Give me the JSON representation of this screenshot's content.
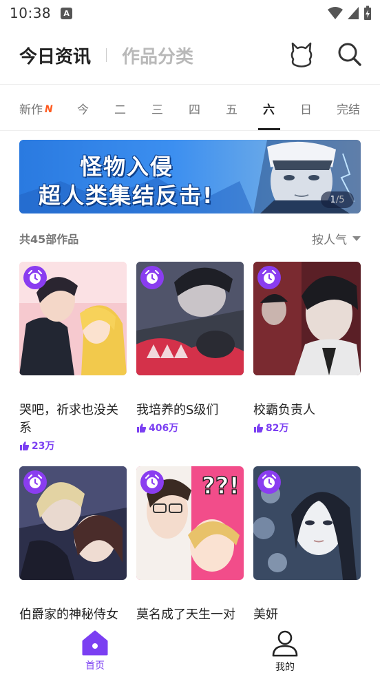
{
  "status_bar": {
    "time": "10:38",
    "notification_icon": "a-box-icon"
  },
  "header": {
    "active_tab": "今日资讯",
    "tab2": "作品分类",
    "icons": [
      "bear-icon",
      "search-icon"
    ]
  },
  "day_tabs": {
    "items": [
      {
        "label": "新作",
        "badge": "N"
      },
      {
        "label": "今"
      },
      {
        "label": "二"
      },
      {
        "label": "三"
      },
      {
        "label": "四"
      },
      {
        "label": "五"
      },
      {
        "label": "六"
      },
      {
        "label": "日"
      },
      {
        "label": "完结"
      }
    ],
    "selected": "六"
  },
  "banner": {
    "line1": "怪物入侵",
    "line2": "超人类集结反击!",
    "current": "1",
    "total": "/5"
  },
  "list": {
    "count_text": "共45部作品",
    "sort_label": "按人气"
  },
  "cards": [
    {
      "title": "哭吧，祈求也没关系",
      "likes": "23万"
    },
    {
      "title": "我培养的S级们",
      "likes": "406万"
    },
    {
      "title": "校霸负责人",
      "likes": "82万"
    },
    {
      "title": "伯爵家的神秘侍女",
      "likes": ""
    },
    {
      "title": "莫名成了天生一对",
      "likes": ""
    },
    {
      "title": "美妍",
      "likes": ""
    }
  ],
  "bottom_nav": {
    "home": "首页",
    "me": "我的",
    "active_color": "#7b3ff2"
  },
  "colors": {
    "accent": "#7b3ff2",
    "new_badge": "#ff5a1f"
  }
}
